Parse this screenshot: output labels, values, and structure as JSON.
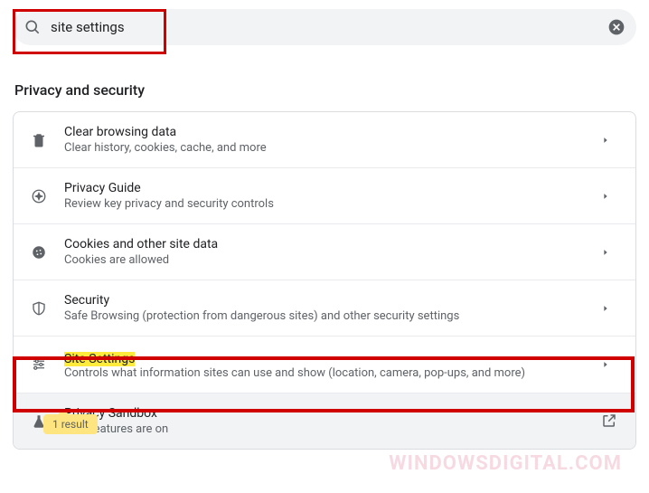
{
  "search": {
    "value": "site settings"
  },
  "section": {
    "title": "Privacy and security"
  },
  "rows": [
    {
      "title": "Clear browsing data",
      "desc": "Clear history, cookies, cache, and more"
    },
    {
      "title": "Privacy Guide",
      "desc": "Review key privacy and security controls"
    },
    {
      "title": "Cookies and other site data",
      "desc": "Cookies are allowed"
    },
    {
      "title": "Security",
      "desc": "Safe Browsing (protection from dangerous sites) and other security settings"
    },
    {
      "title": "Site Settings",
      "desc": "Controls what information sites can use and show (location, camera, pop-ups, and more)"
    },
    {
      "title": "Privacy Sandbox",
      "desc": "Trial features are on"
    }
  ],
  "tooltip": {
    "text": "1 result"
  },
  "watermark": {
    "text": "WINDOWSDIGITAL.COM"
  }
}
